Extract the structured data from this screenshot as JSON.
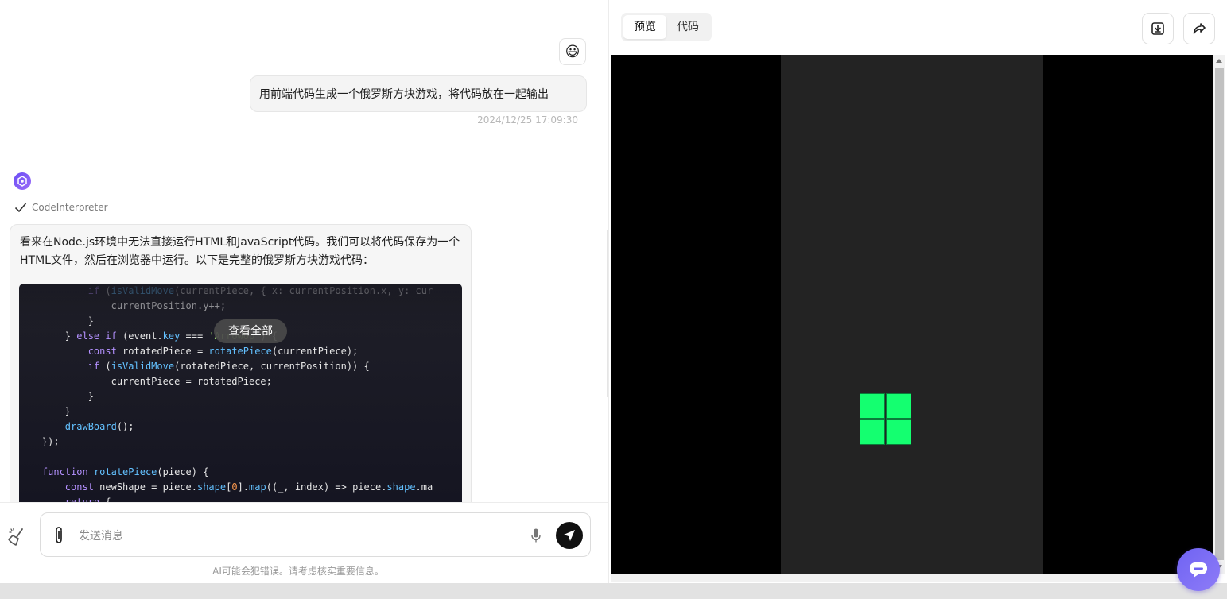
{
  "chat": {
    "emoji": "😃",
    "user_message": "用前端代码生成一个俄罗斯方块游戏，将代码放在一起输出",
    "timestamp": "2024/12/25 17:09:30",
    "tool_name": "CodeInterpreter",
    "bot_text": "看来在Node.js环境中无法直接运行HTML和JavaScript代码。我们可以将代码保存为一个HTML文件，然后在浏览器中运行。以下是完整的俄罗斯方块游戏代码：",
    "view_all_label": "查看全部",
    "code_lines": [
      "            if (isValidMove(currentPiece, { x: currentPosition.x, y: cur",
      "                currentPosition.y++;",
      "            }",
      "        } else if (event.key === 'ArrowUp') {",
      "            const rotatedPiece = rotatePiece(currentPiece);",
      "            if (isValidMove(rotatedPiece, currentPosition)) {",
      "                currentPiece = rotatedPiece;",
      "            }",
      "        }",
      "        drawBoard();",
      "    });",
      "",
      "    function rotatePiece(piece) {",
      "        const newShape = piece.shape[0].map((_, index) => piece.shape.ma",
      "        return {"
    ]
  },
  "input": {
    "placeholder": "发送消息",
    "disclaimer": "AI可能会犯错误。请考虑核实重要信息。"
  },
  "preview": {
    "tabs": [
      {
        "label": "预览",
        "active": true
      },
      {
        "label": "代码",
        "active": false
      }
    ],
    "piece_color": "#14ff70",
    "board_color": "#232323"
  },
  "icons": {
    "download": "download-icon",
    "share": "share-icon",
    "help": "chat-help-icon"
  }
}
